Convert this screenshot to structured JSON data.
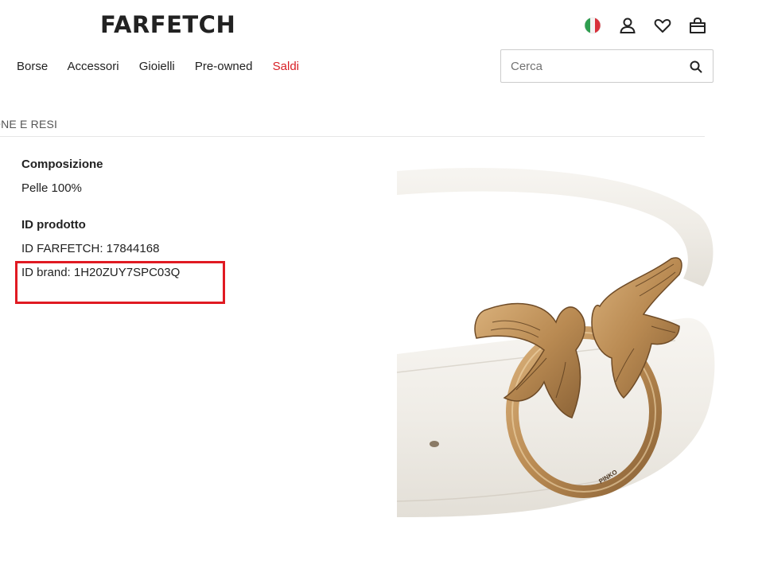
{
  "header": {
    "logo": "FARFETCH",
    "icons": [
      "flag-italy-icon",
      "account-icon",
      "heart-icon",
      "shopping-bag-icon"
    ]
  },
  "nav": {
    "items": [
      {
        "label": "Borse"
      },
      {
        "label": "Accessori"
      },
      {
        "label": "Gioielli"
      },
      {
        "label": "Pre-owned"
      },
      {
        "label": "Saldi",
        "color": "#d81f25"
      }
    ]
  },
  "search": {
    "placeholder": "Cerca",
    "value": ""
  },
  "section_tab": {
    "label": "ONE E RESI"
  },
  "details": {
    "composition_heading": "Composizione",
    "composition_value": "Pelle 100%",
    "id_heading": "ID prodotto",
    "id_farfetch": "ID FARFETCH: 17844168",
    "id_brand": "ID brand: 1H20ZUY7SPC03Q"
  },
  "highlight": {
    "color": "#e01a22"
  },
  "product_image": {
    "brand_engraving": "PINKO"
  },
  "colors": {
    "text": "#222222",
    "sale": "#d81f25",
    "border": "#cccccc"
  }
}
